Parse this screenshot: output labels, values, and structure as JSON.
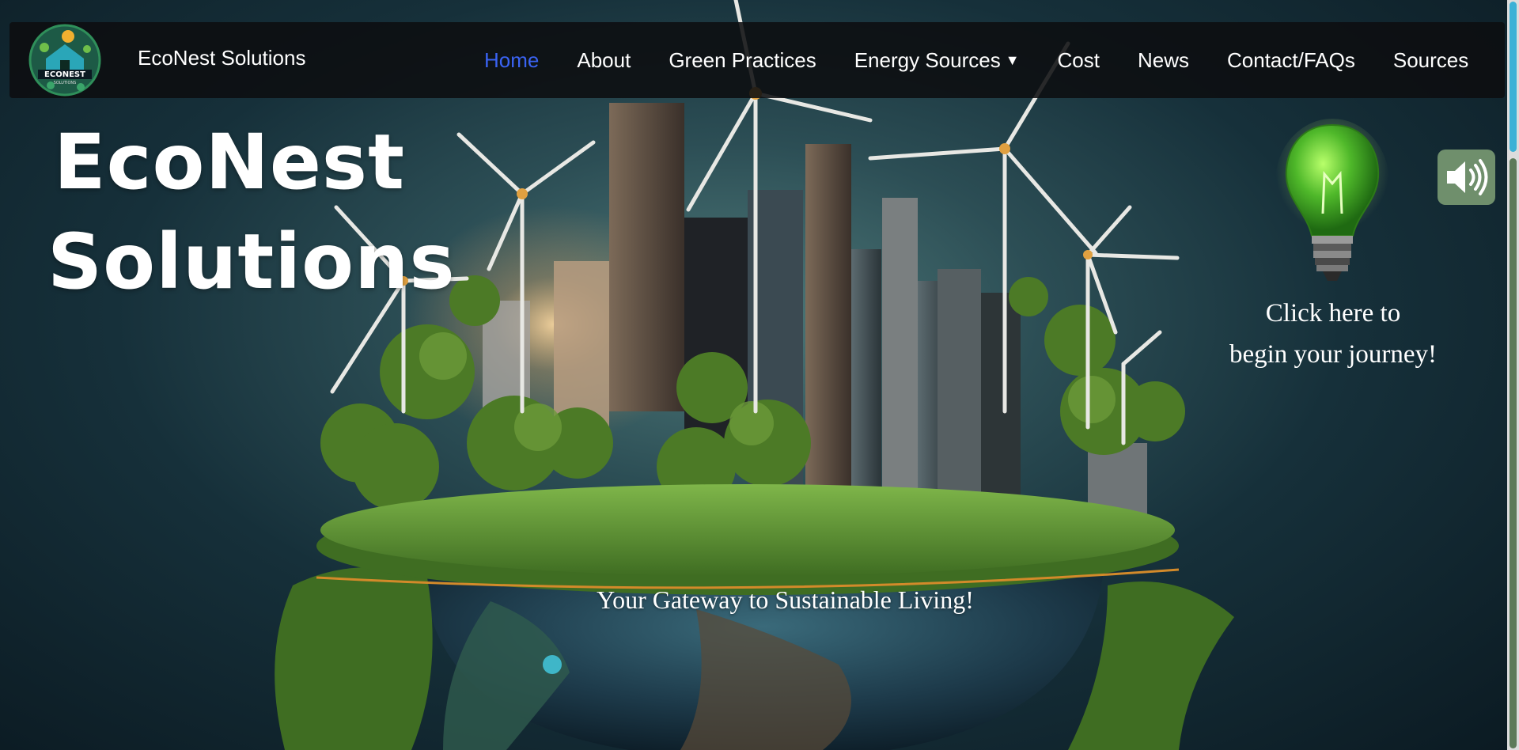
{
  "brand": {
    "logo_icon": "econest-logo-icon",
    "name": "EcoNest Solutions"
  },
  "nav": {
    "items": [
      {
        "label": "Home",
        "active": true
      },
      {
        "label": "About"
      },
      {
        "label": "Green Practices"
      },
      {
        "label": "Energy Sources",
        "dropdown": true,
        "icon": "caret-down-icon"
      },
      {
        "label": "Cost"
      },
      {
        "label": "News"
      },
      {
        "label": "Contact/FAQs"
      },
      {
        "label": "Sources"
      }
    ]
  },
  "hero": {
    "title_line1": "EcoNest",
    "title_line2": "Solutions",
    "tagline": "Your Gateway to Sustainable Living!",
    "journey_line1": "Click here to",
    "journey_line2": "begin your journey!",
    "bulb_icon": "lightbulb-icon",
    "sound_icon": "speaker-volume-icon"
  },
  "colors": {
    "active_link": "#3a63f2",
    "navbar_bg": "#0c0e10",
    "sound_button_bg": "#6f8f6c",
    "scroll_thumb": "#3bb1d6"
  }
}
